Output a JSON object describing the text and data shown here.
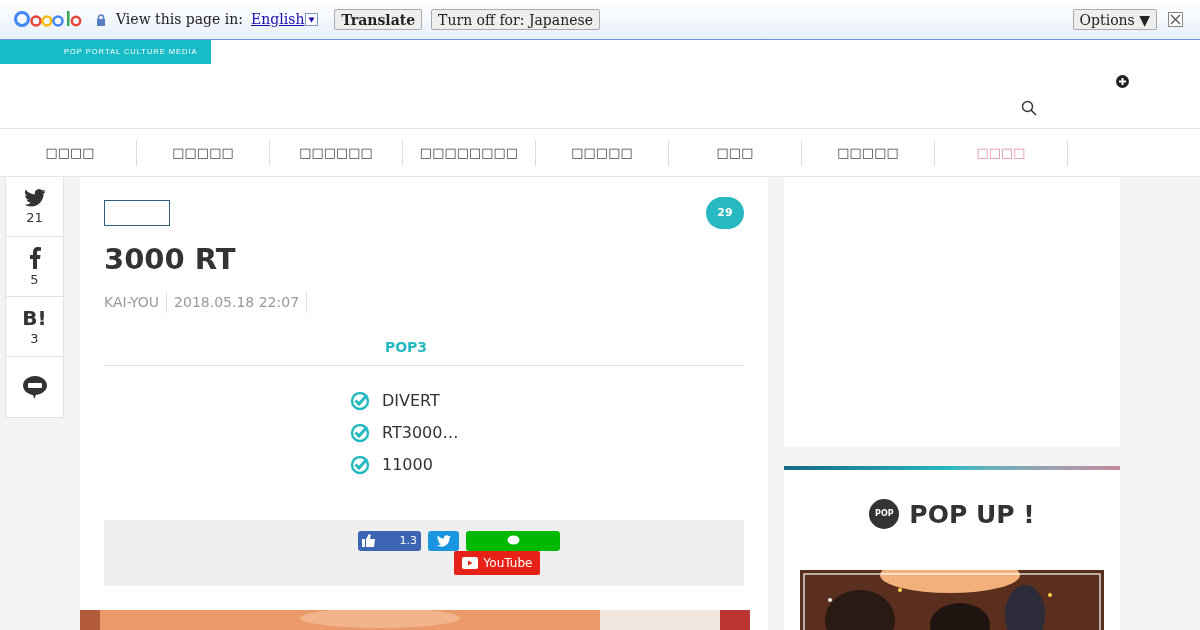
{
  "translate_bar": {
    "prompt": "View this page in:",
    "language": "English",
    "translate_button": "Translate",
    "turn_off_button": "Turn off for: Japanese",
    "options_button": "Options ▼"
  },
  "header": {
    "tagline": "POP PORTAL CULTURE MEDIA"
  },
  "nav": [
    {
      "label": "□□□□",
      "selected": false
    },
    {
      "label": "□□□□□",
      "selected": false
    },
    {
      "label": "□□□□□□",
      "selected": false
    },
    {
      "label": "□□□□□□□□",
      "selected": false
    },
    {
      "label": "□□□□□",
      "selected": false
    },
    {
      "label": "□□□",
      "selected": false
    },
    {
      "label": "□□□□□",
      "selected": false
    },
    {
      "label": "□□□□",
      "selected": true
    }
  ],
  "share_rail": [
    {
      "kind": "twitter",
      "count": "21"
    },
    {
      "kind": "facebook",
      "count": "5"
    },
    {
      "kind": "hatena",
      "glyph": "B!",
      "count": "3"
    },
    {
      "kind": "line"
    }
  ],
  "article": {
    "comment_count": "29",
    "title": "3000 RT",
    "author": "KAI-YOU",
    "date": "2018.05.18 22:07",
    "summary_heading": "POP3",
    "points": [
      "DIVERT",
      "RT3000…",
      "11000"
    ],
    "share_bar": {
      "like_count": "1.3",
      "youtube": "YouTube"
    }
  },
  "sidebar": {
    "popup_badge": "POP",
    "popup_title": "POP UP !"
  }
}
